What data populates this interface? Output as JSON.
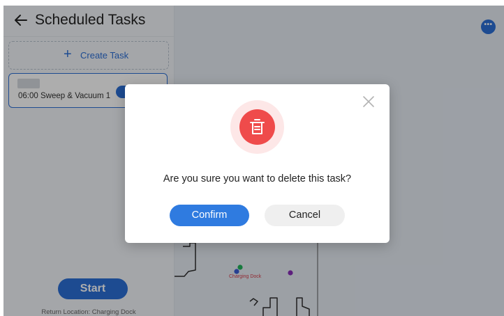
{
  "header": {
    "title": "Scheduled Tasks"
  },
  "sidebar": {
    "create_task_label": "Create Task",
    "tasks": [
      {
        "label": "06:00 Sweep & Vacuum 1",
        "enabled": true
      }
    ],
    "start_label": "Start",
    "return_location": "Return Location: Charging Dock"
  },
  "map": {
    "dock_label": "Charging Dock"
  },
  "dialog": {
    "message": "Are you sure you want to delete this task?",
    "confirm_label": "Confirm",
    "cancel_label": "Cancel"
  },
  "icons": {
    "back": "arrow-left-icon",
    "more": "more-horizontal-icon",
    "close": "close-icon",
    "trash": "trash-icon",
    "plus": "plus-icon"
  },
  "colors": {
    "accent": "#2c6fd6",
    "danger": "#ef4b4b",
    "danger_soft": "#fde7e7",
    "cancel_bg": "#efefef"
  }
}
